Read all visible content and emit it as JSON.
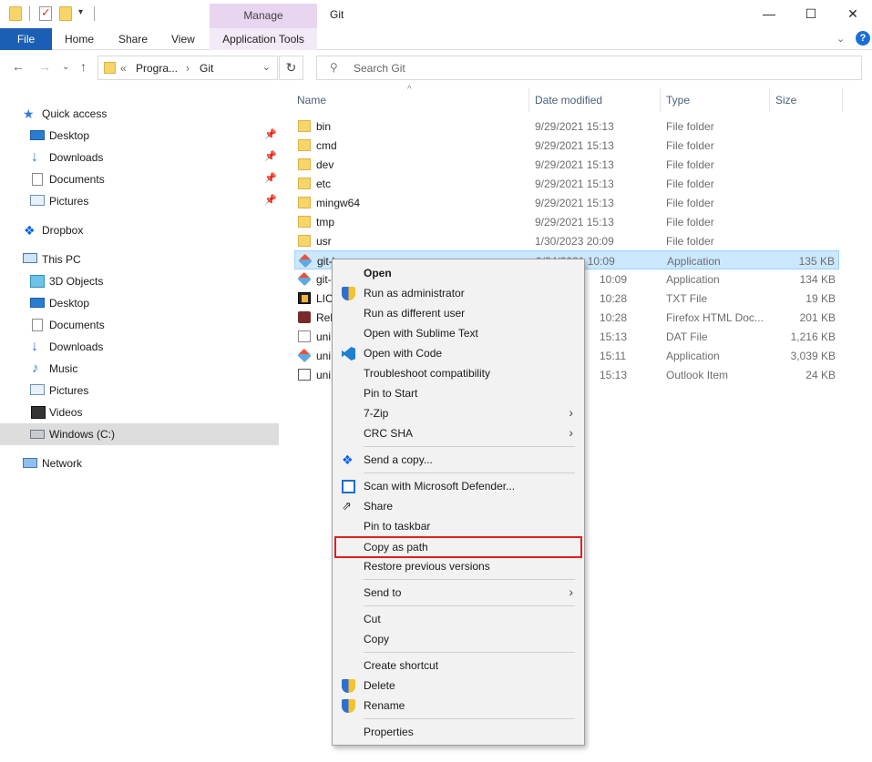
{
  "window": {
    "title": "Git",
    "manage_label": "Manage",
    "minimize": "—",
    "maximize": "☐",
    "close": "✕"
  },
  "ribbon": {
    "tabs": [
      "File",
      "Home",
      "Share",
      "View",
      "Application Tools"
    ],
    "collapse": "⌄",
    "help": "?"
  },
  "address": {
    "overflow": "«",
    "crumbs": [
      "Progra...",
      "Git"
    ],
    "separator": "›",
    "dropdown": "⌄",
    "refresh": "↻",
    "back": "←",
    "forward": "→",
    "recent": "⌄",
    "up": "↑"
  },
  "search": {
    "placeholder": "Search Git"
  },
  "nav_pane": {
    "items": [
      {
        "label": "Quick access",
        "icon": "star-icon",
        "pinned": false
      },
      {
        "label": "Desktop",
        "icon": "desktop-icon",
        "pinned": true
      },
      {
        "label": "Downloads",
        "icon": "downloads-icon",
        "pinned": true
      },
      {
        "label": "Documents",
        "icon": "documents-icon",
        "pinned": true
      },
      {
        "label": "Pictures",
        "icon": "pictures-icon",
        "pinned": true
      },
      {
        "label": "Dropbox",
        "icon": "dropbox-icon",
        "pinned": false
      },
      {
        "label": "This PC",
        "icon": "this-pc-icon",
        "pinned": false
      },
      {
        "label": "3D Objects",
        "icon": "3d-objects-icon",
        "pinned": false
      },
      {
        "label": "Desktop",
        "icon": "desktop-icon",
        "pinned": false
      },
      {
        "label": "Documents",
        "icon": "documents-icon",
        "pinned": false
      },
      {
        "label": "Downloads",
        "icon": "downloads-icon",
        "pinned": false
      },
      {
        "label": "Music",
        "icon": "music-icon",
        "pinned": false
      },
      {
        "label": "Pictures",
        "icon": "pictures-icon",
        "pinned": false
      },
      {
        "label": "Videos",
        "icon": "videos-icon",
        "pinned": false
      },
      {
        "label": "Windows  (C:)",
        "icon": "drive-icon",
        "pinned": false,
        "selected": true
      },
      {
        "label": "Network",
        "icon": "network-icon",
        "pinned": false
      }
    ]
  },
  "file_list": {
    "columns": [
      "Name",
      "Date modified",
      "Type",
      "Size"
    ],
    "sort_indicator": "^",
    "rows": [
      {
        "name": "bin",
        "date": "9/29/2021 15:13",
        "type": "File folder",
        "size": "",
        "icon": "folder-icon"
      },
      {
        "name": "cmd",
        "date": "9/29/2021 15:13",
        "type": "File folder",
        "size": "",
        "icon": "folder-icon"
      },
      {
        "name": "dev",
        "date": "9/29/2021 15:13",
        "type": "File folder",
        "size": "",
        "icon": "folder-icon"
      },
      {
        "name": "etc",
        "date": "9/29/2021 15:13",
        "type": "File folder",
        "size": "",
        "icon": "folder-icon"
      },
      {
        "name": "mingw64",
        "date": "9/29/2021 15:13",
        "type": "File folder",
        "size": "",
        "icon": "folder-icon"
      },
      {
        "name": "tmp",
        "date": "9/29/2021 15:13",
        "type": "File folder",
        "size": "",
        "icon": "folder-icon"
      },
      {
        "name": "usr",
        "date": "1/30/2023 20:09",
        "type": "File folder",
        "size": "",
        "icon": "folder-icon"
      },
      {
        "name": "git-b",
        "date": "9/24/2021 10:09",
        "type": "Application",
        "size": "135 KB",
        "icon": "git-icon",
        "selected": true
      },
      {
        "name": "git-",
        "date": "10:09",
        "type": "Application",
        "size": "134 KB",
        "icon": "git-icon"
      },
      {
        "name": "LIC",
        "date": "10:28",
        "type": "TXT File",
        "size": "19 KB",
        "icon": "sublime-text-icon"
      },
      {
        "name": "Rel",
        "date": "10:28",
        "type": "Firefox HTML Doc...",
        "size": "201 KB",
        "icon": "firefox-icon"
      },
      {
        "name": "uni",
        "date": "15:13",
        "type": "DAT File",
        "size": "1,216 KB",
        "icon": "file-icon"
      },
      {
        "name": "uni",
        "date": "15:11",
        "type": "Application",
        "size": "3,039 KB",
        "icon": "git-icon"
      },
      {
        "name": "uni",
        "date": "15:13",
        "type": "Outlook Item",
        "size": "24 KB",
        "icon": "mail-icon"
      }
    ]
  },
  "context_menu": {
    "items": [
      {
        "label": "Open",
        "bold": true
      },
      {
        "label": "Run as administrator",
        "icon": "shield-icon"
      },
      {
        "label": "Run as different user"
      },
      {
        "label": "Open with Sublime Text"
      },
      {
        "label": "Open with Code",
        "icon": "vscode-icon"
      },
      {
        "label": "Troubleshoot compatibility"
      },
      {
        "label": "Pin to Start"
      },
      {
        "label": "7-Zip",
        "submenu": true
      },
      {
        "label": "CRC SHA",
        "submenu": true
      },
      {
        "label": "Send a copy...",
        "icon": "dropbox-icon"
      },
      {
        "label": "Scan with Microsoft Defender...",
        "icon": "defender-icon"
      },
      {
        "label": "Share",
        "icon": "share-icon"
      },
      {
        "label": "Pin to taskbar"
      },
      {
        "label": "Copy as path",
        "highlighted": true
      },
      {
        "label": "Restore previous versions"
      },
      {
        "label": "Send to",
        "submenu": true
      },
      {
        "label": "Cut"
      },
      {
        "label": "Copy"
      },
      {
        "label": "Create shortcut"
      },
      {
        "label": "Delete",
        "icon": "shield-icon"
      },
      {
        "label": "Rename",
        "icon": "shield-icon"
      },
      {
        "label": "Properties"
      }
    ],
    "submenu_arrow": "›",
    "highlight_color": "#e0201f"
  },
  "colors": {
    "file_tab": "#1a5fb4",
    "manage_tab": "#e8d5f0",
    "selection": "#cce8ff",
    "nav_selected": "#dddddd"
  }
}
